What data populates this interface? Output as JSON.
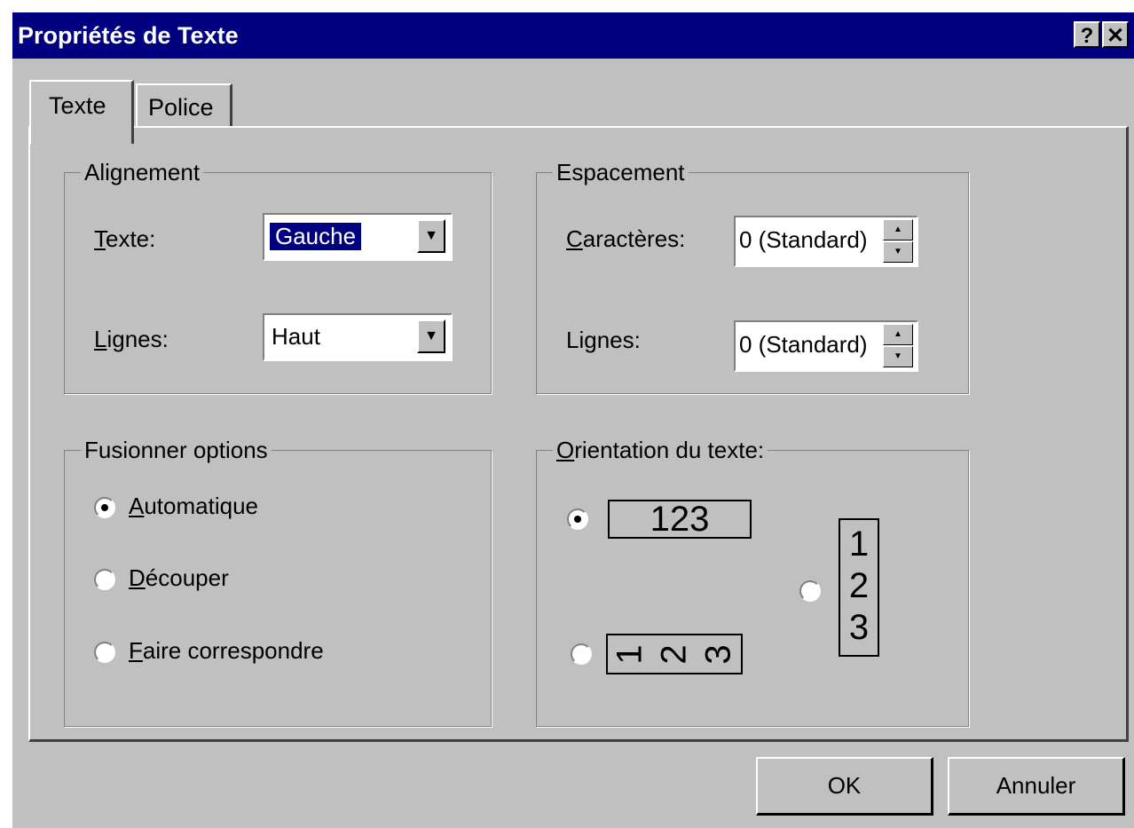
{
  "window": {
    "title": "Propriétés de Texte",
    "help_label": "?",
    "close_label": "✕"
  },
  "tabs": [
    {
      "label": "Texte",
      "active": true
    },
    {
      "label": "Police",
      "active": false
    }
  ],
  "alignement": {
    "legend": "Alignement",
    "texte": {
      "label_mnemonic": "T",
      "label_rest": "exte:",
      "value": "Gauche"
    },
    "lignes": {
      "label_mnemonic": "L",
      "label_rest": "ignes:",
      "value": "Haut"
    }
  },
  "espacement": {
    "legend": "Espacement",
    "caracteres": {
      "label_mnemonic": "C",
      "label_rest": "aractères:",
      "value": "0 (Standard)"
    },
    "lignes": {
      "label": "Lignes:",
      "value": "0 (Standard)"
    }
  },
  "fusionner": {
    "legend": "Fusionner options",
    "options": [
      {
        "mnemonic": "A",
        "rest": "utomatique",
        "checked": true
      },
      {
        "mnemonic": "D",
        "rest": "écouper",
        "checked": false
      },
      {
        "mnemonic": "F",
        "rest": "aire correspondre",
        "checked": false
      }
    ]
  },
  "orientation": {
    "legend_mnemonic": "O",
    "legend_rest": "rientation du texte:",
    "horizontal": {
      "text": "123",
      "checked": true
    },
    "vertical": {
      "chars": [
        "1",
        "2",
        "3"
      ],
      "checked": false
    },
    "rotated": {
      "chars": [
        "1",
        "2",
        "3"
      ],
      "checked": false
    }
  },
  "buttons": {
    "ok": "OK",
    "cancel": "Annuler"
  },
  "icons": {
    "dropdown": "chevron-down-icon",
    "spin_up": "caret-up-icon",
    "spin_down": "caret-down-icon"
  }
}
